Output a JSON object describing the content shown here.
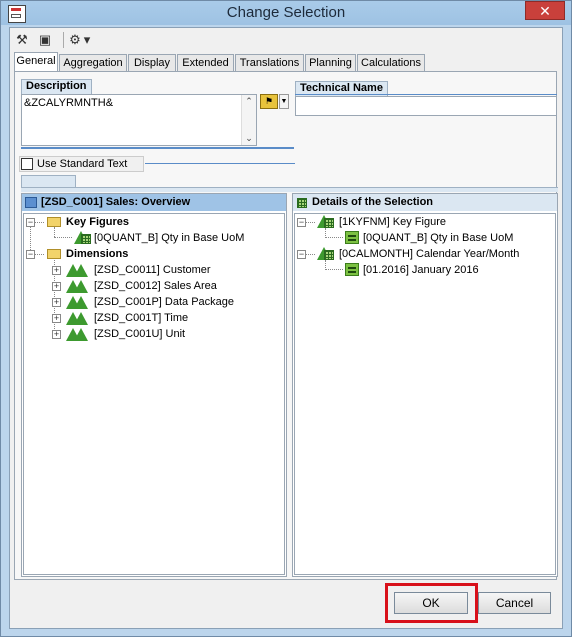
{
  "window": {
    "title": "Change Selection",
    "close_glyph": "✕"
  },
  "toolbar": {
    "buttons": [
      {
        "name": "wand-icon",
        "glyph": "⚒"
      },
      {
        "name": "save-icon",
        "glyph": "▣"
      },
      {
        "name": "tools-icon",
        "glyph": "⚙"
      },
      {
        "name": "tools-dropdown-icon",
        "glyph": "▾"
      }
    ]
  },
  "tabs": [
    "General",
    "Aggregation",
    "Display",
    "Extended",
    "Translations",
    "Planning",
    "Calculations"
  ],
  "general": {
    "description_label": "Description",
    "description_value": "&ZCALYRMNTH&",
    "technical_name_label": "Technical Name",
    "technical_name_value": "",
    "use_standard_text_label": "Use Standard Text",
    "use_standard_text_checked": false
  },
  "left_pane": {
    "title": "[ZSD_C001] Sales: Overview",
    "tree": {
      "key_figures": {
        "label": "Key Figures",
        "items": [
          "[0QUANT_B] Qty in Base UoM"
        ]
      },
      "dimensions": {
        "label": "Dimensions",
        "items": [
          "[ZSD_C0011] Customer",
          "[ZSD_C0012] Sales Area",
          "[ZSD_C001P] Data Package",
          "[ZSD_C001T] Time",
          "[ZSD_C001U] Unit"
        ]
      }
    }
  },
  "right_pane": {
    "title": "Details of the Selection",
    "tree": [
      {
        "label": "[1KYFNM] Key Figure",
        "child": "[0QUANT_B] Qty in Base UoM"
      },
      {
        "label": "[0CALMONTH] Calendar Year/Month",
        "child": "[01.2016] January 2016"
      }
    ]
  },
  "buttons": {
    "ok": "OK",
    "cancel": "Cancel"
  },
  "colors": {
    "highlight": "#d8101a",
    "title_bar": "#a9cbe9",
    "close": "#c9403b"
  }
}
